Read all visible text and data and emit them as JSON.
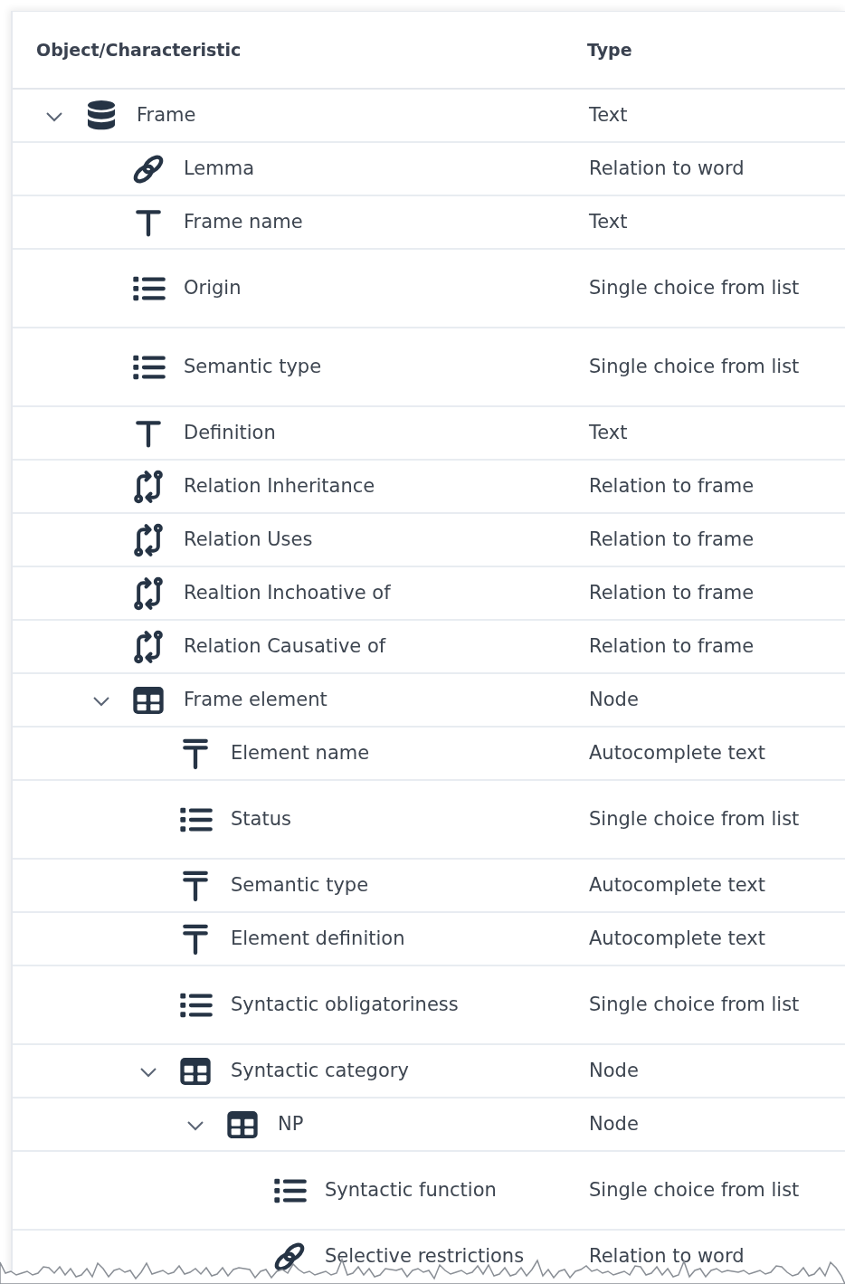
{
  "table": {
    "columns": [
      "Object/Characteristic",
      "Type"
    ],
    "rows": [
      {
        "name": "Frame",
        "type": "Text",
        "kind": "database",
        "expanded": true,
        "children": [
          {
            "name": "Lemma",
            "type": "Relation to word",
            "kind": "link"
          },
          {
            "name": "Frame name",
            "type": "Text",
            "kind": "text"
          },
          {
            "name": "Origin",
            "type": "Single choice from list",
            "kind": "list"
          },
          {
            "name": "Semantic type",
            "type": "Single choice from list",
            "kind": "list"
          },
          {
            "name": "Definition",
            "type": "Text",
            "kind": "text"
          },
          {
            "name": "Relation Inheritance",
            "type": "Relation to frame",
            "kind": "relation"
          },
          {
            "name": "Relation Uses",
            "type": "Relation to frame",
            "kind": "relation"
          },
          {
            "name": "Realtion Inchoative of",
            "type": "Relation to frame",
            "kind": "relation"
          },
          {
            "name": "Relation Causative of",
            "type": "Relation to frame",
            "kind": "relation"
          },
          {
            "name": "Frame element",
            "type": "Node",
            "kind": "node",
            "expanded": true,
            "children": [
              {
                "name": "Element name",
                "type": "Autocomplete text",
                "kind": "autotext"
              },
              {
                "name": "Status",
                "type": "Single choice from list",
                "kind": "list"
              },
              {
                "name": "Semantic type",
                "type": "Autocomplete text",
                "kind": "autotext"
              },
              {
                "name": "Element definition",
                "type": "Autocomplete text",
                "kind": "autotext"
              },
              {
                "name": "Syntactic obligatoriness",
                "type": "Single choice from list",
                "kind": "list"
              },
              {
                "name": "Syntactic category",
                "type": "Node",
                "kind": "node",
                "expanded": true,
                "children": [
                  {
                    "name": "NP",
                    "type": "Node",
                    "kind": "node",
                    "expanded": true,
                    "children": [
                      {
                        "name": "Syntactic function",
                        "type": "Single choice from list",
                        "kind": "list"
                      },
                      {
                        "name": "Selective restrictions",
                        "type": "Relation to word",
                        "kind": "link"
                      }
                    ]
                  }
                ]
              }
            ]
          }
        ]
      }
    ]
  }
}
